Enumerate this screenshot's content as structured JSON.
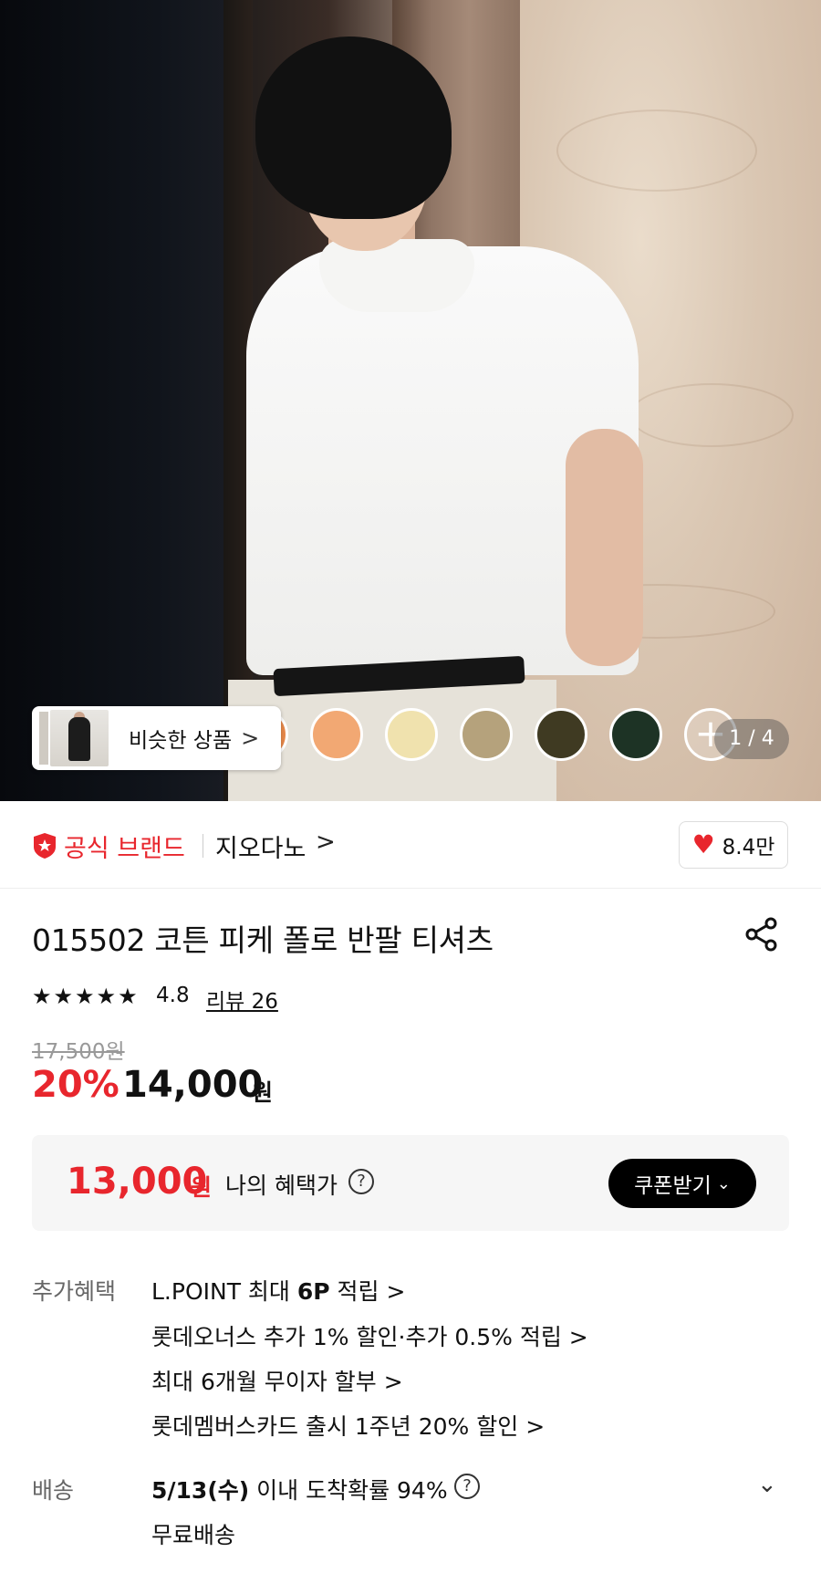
{
  "hero": {
    "similar_label": "비슷한 상품",
    "similar_chevron": ">",
    "pager": "1 / 4",
    "color_swatches": [
      "#e7884a",
      "#f2a873",
      "#f0e2ae",
      "#b5a27c",
      "#3f3a22",
      "#1d3325"
    ],
    "more_swatch": "+"
  },
  "brand": {
    "official_label": "공식 브랜드",
    "name": "지오다노",
    "chevron": ">",
    "likes": "8.4만",
    "accent": "#e8262d"
  },
  "product": {
    "title": "015502 코튼 피케 폴로 반팔 티셔츠",
    "stars": "★★★★★",
    "rating": "4.8",
    "reviews": "리뷰 26",
    "original_price": "17,500원",
    "discount": "20%",
    "sale_price": "14,000",
    "sale_unit": "원"
  },
  "benefit_price": {
    "price": "13,000",
    "unit": "원",
    "label": "나의 혜택가",
    "help": "?",
    "coupon_button": "쿠폰받기",
    "coupon_chevron": "⌄"
  },
  "extra_benefits": {
    "label": "추가혜택",
    "items": [
      {
        "pre": "L.POINT 최대 ",
        "bold": "6P",
        "post": " 적립 >"
      },
      {
        "pre": "롯데오너스 추가 1% 할인·추가 0.5% 적립 >",
        "bold": "",
        "post": ""
      },
      {
        "pre": "최대 6개월 무이자 할부 >",
        "bold": "",
        "post": ""
      },
      {
        "pre": "롯데멤버스카드 출시 1주년 20% 할인 >",
        "bold": "",
        "post": ""
      }
    ]
  },
  "shipping": {
    "label": "배송",
    "date": "5/13(수)",
    "date_rest": " 이내 도착확률 94%",
    "help": "?",
    "free": "무료배송",
    "expand": "⌄"
  }
}
